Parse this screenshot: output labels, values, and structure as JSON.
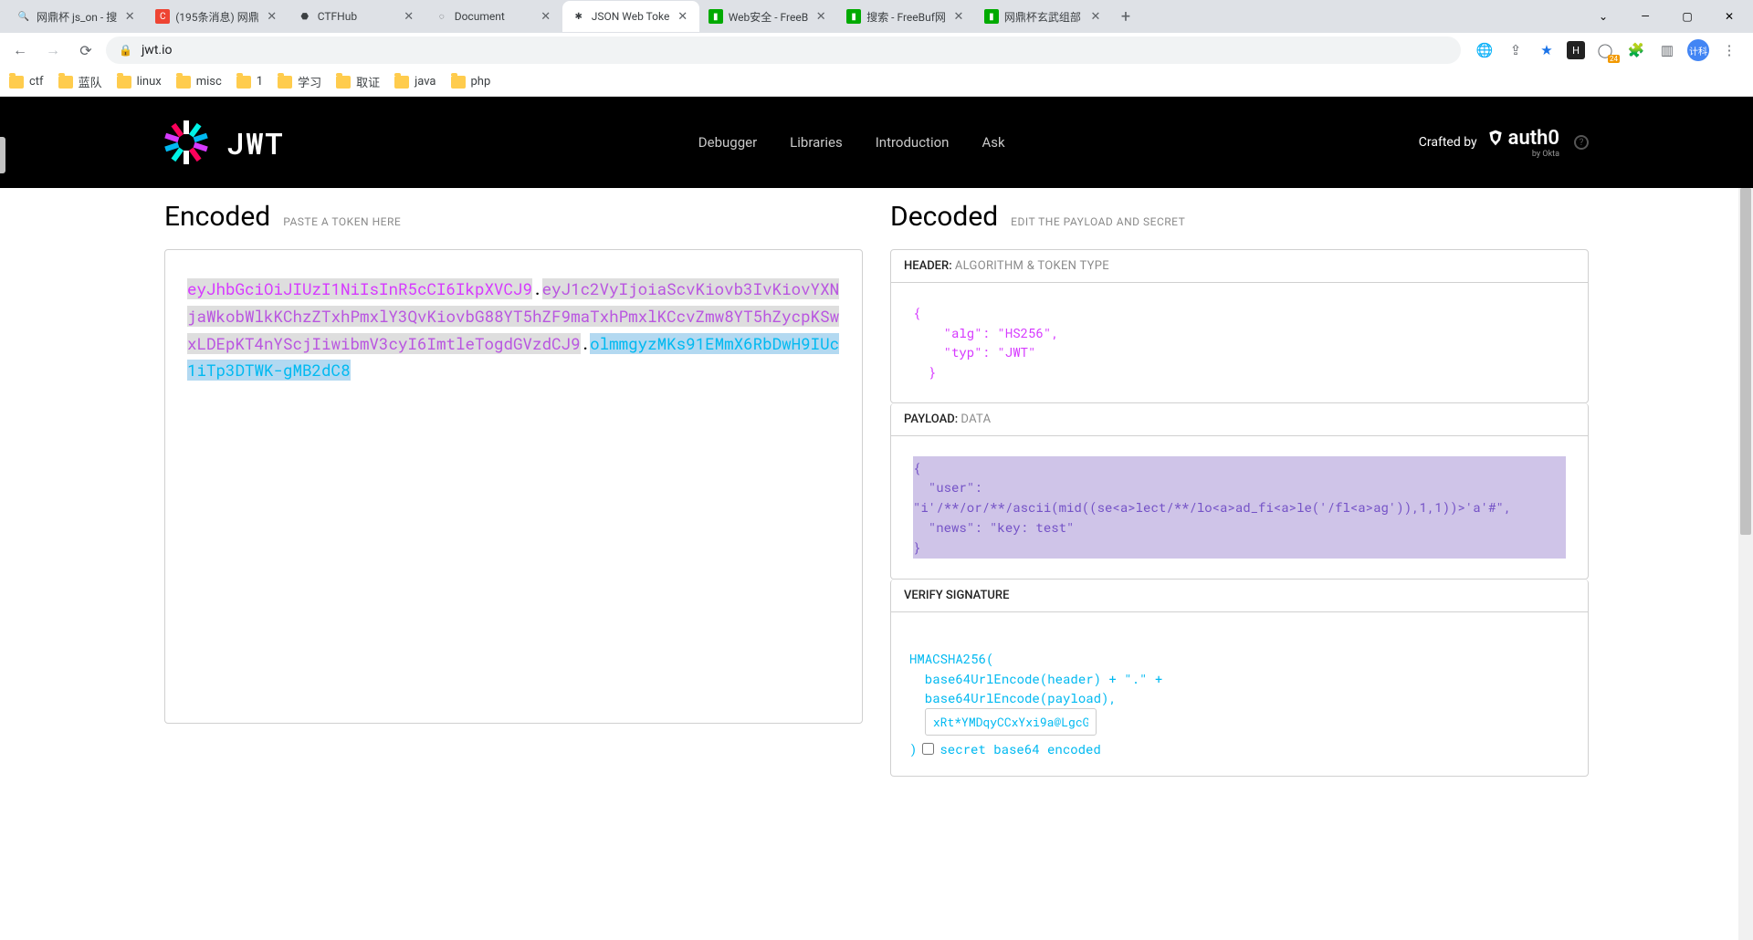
{
  "browser": {
    "tabs": [
      {
        "favicon": "search",
        "title": "网鼎杯 js_on - 搜"
      },
      {
        "favicon": "c",
        "title": "(195条消息) 网鼎"
      },
      {
        "favicon": "shield",
        "title": "CTFHub"
      },
      {
        "favicon": "spin",
        "title": "Document"
      },
      {
        "favicon": "jwt",
        "title": "JSON Web Toke",
        "active": true
      },
      {
        "favicon": "fb",
        "title": "Web安全 - FreeB"
      },
      {
        "favicon": "fb",
        "title": "搜索 - FreeBuf网"
      },
      {
        "favicon": "fb",
        "title": "网鼎杯玄武组部"
      }
    ],
    "url": "jwt.io",
    "bookmarks": [
      "ctf",
      "蓝队",
      "linux",
      "misc",
      "1",
      "学习",
      "取证",
      "java",
      "php"
    ],
    "avatar_text": "计科",
    "ext_badge": "24"
  },
  "nav": {
    "crafted": "Crafted by",
    "brand": "auth0",
    "brand_sub": "by Okta",
    "links": [
      "Debugger",
      "Libraries",
      "Introduction",
      "Ask"
    ]
  },
  "encoded": {
    "title": "Encoded",
    "sub": "PASTE A TOKEN HERE",
    "header_part": "eyJhbGciOiJIUzI1NiIsInR5cCI6IkpXVCJ9",
    "payload_part": "eyJ1c2VyIjoiaScvKiovb3IvKiovYXNjaWkobWlkKChzZTxhPmxlY3QvKiovbG88YT5hZF9maTxhPmxlKCcvZmw8YT5hZycpKSwxLDEpKT4nYScjIiwibmV3cyI6ImtleTogdGVzdCJ9",
    "sig_part": "olmmgyzMKs91EMmX6RbDwH9IUc1iTp3DTWK-gMB2dC8"
  },
  "decoded": {
    "title": "Decoded",
    "sub": "EDIT THE PAYLOAD AND SECRET",
    "header_label": "HEADER:",
    "header_sub": "ALGORITHM & TOKEN TYPE",
    "header_json": "{\n    \"alg\": \"HS256\",\n    \"typ\": \"JWT\"\n  }",
    "payload_label": "PAYLOAD:",
    "payload_sub": "DATA",
    "payload_json": "{\n  \"user\":\n\"i'/**/or/**/ascii(mid((se<a>lect/**/lo<a>ad_fi<a>le('/fl<a>ag')),1,1))>'a'#\",\n  \"news\": \"key: test\"\n}",
    "sig_label": "VERIFY SIGNATURE",
    "sig_line1": "HMACSHA256(",
    "sig_line2": "  base64UrlEncode(header) + \".\" +",
    "sig_line3": "  base64UrlEncode(payload),",
    "sig_secret": "xRt*YMDqyCCxYxi9a@LgcG",
    "sig_close": ")",
    "sig_checkbox_label": "secret base64 encoded"
  }
}
